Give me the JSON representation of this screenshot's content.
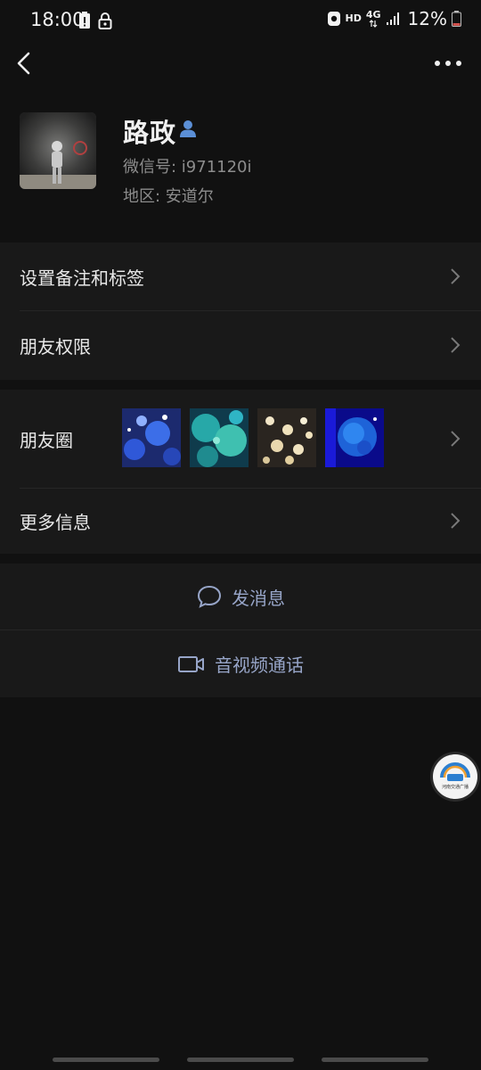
{
  "status_bar": {
    "time": "18:00",
    "network_hd": "HD",
    "network_4g": "4G",
    "battery": "12%"
  },
  "profile": {
    "name": "路政",
    "wechat_id": "微信号: i971120i",
    "region": "地区: 安道尔"
  },
  "menu": {
    "remarks_tags": "设置备注和标签",
    "friend_permissions": "朋友权限",
    "moments": "朋友圈",
    "more_info": "更多信息"
  },
  "actions": {
    "send_message": "发消息",
    "video_call": "音视频通话"
  },
  "floating_logo": {
    "text": "河南交通广播"
  },
  "colors": {
    "background": "#111111",
    "section": "#191919",
    "action_text": "#97a5c8",
    "contact_icon": "#5b8fd6"
  }
}
